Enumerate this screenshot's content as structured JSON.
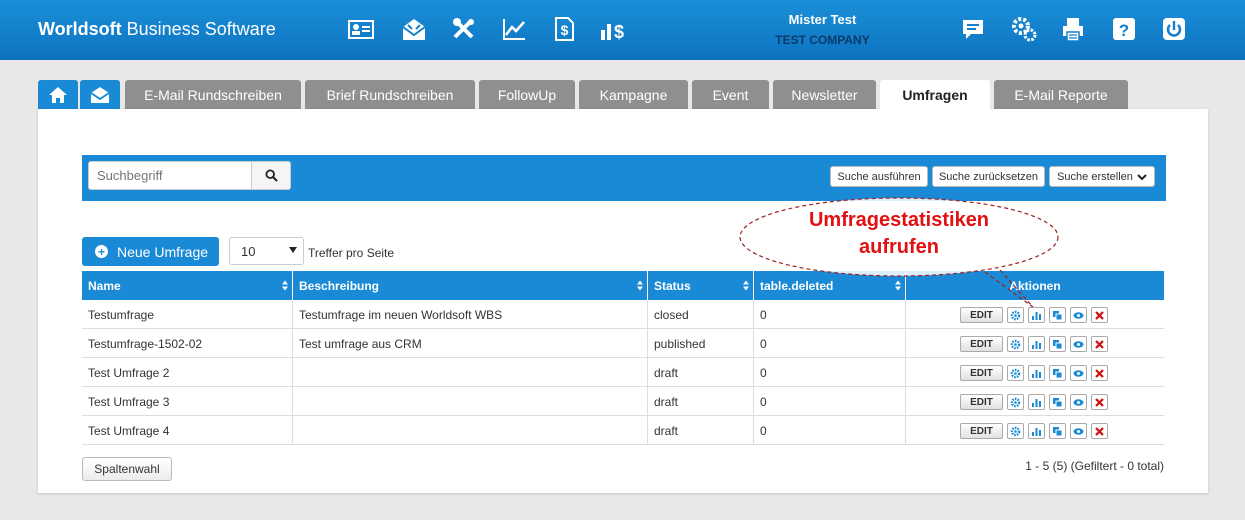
{
  "app": {
    "brand_bold": "Worldsoft",
    "brand_rest": " Business Software"
  },
  "topnav": {
    "icons": [
      "contact-card-icon",
      "mail-broadcast-icon",
      "tools-icon",
      "chart-line-icon",
      "invoice-dollar-icon",
      "bar-dollar-icon"
    ],
    "right_icons": [
      "chat-icon",
      "settings-gears-icon",
      "print-icon",
      "help-icon",
      "power-icon"
    ]
  },
  "user": {
    "name": "Mister Test",
    "company": "TEST COMPANY"
  },
  "tabs": [
    {
      "label": "E-Mail Rundschreiben"
    },
    {
      "label": "Brief Rundschreiben"
    },
    {
      "label": "FollowUp"
    },
    {
      "label": "Kampagne"
    },
    {
      "label": "Event"
    },
    {
      "label": "Newsletter"
    },
    {
      "label": "Umfragen"
    },
    {
      "label": "E-Mail Reporte"
    }
  ],
  "active_tab": "Umfragen",
  "search": {
    "placeholder": "Suchbegriff",
    "execute_label": "Suche ausführen",
    "reset_label": "Suche zurücksetzen",
    "create_label": "Suche erstellen"
  },
  "toolbar": {
    "new_label": "Neue Umfrage",
    "per_page_value": "10",
    "per_page_label": "Treffer pro Seite"
  },
  "table": {
    "columns": [
      "Name",
      "Beschreibung",
      "Status",
      "table.deleted",
      "Aktionen"
    ],
    "rows": [
      {
        "name": "Testumfrage",
        "description": "Testumfrage im neuen Worldsoft WBS",
        "status": "closed",
        "deleted": "0"
      },
      {
        "name": "Testumfrage-1502-02",
        "description": "Test umfrage aus CRM",
        "status": "published",
        "deleted": "0"
      },
      {
        "name": "Test Umfrage 2",
        "description": "",
        "status": "draft",
        "deleted": "0"
      },
      {
        "name": "Test Umfrage 3",
        "description": "",
        "status": "draft",
        "deleted": "0"
      },
      {
        "name": "Test Umfrage 4",
        "description": "",
        "status": "draft",
        "deleted": "0"
      }
    ],
    "edit_label": "EDIT",
    "action_icons": [
      "settings-icon",
      "statistics-icon",
      "copy-icon",
      "preview-icon",
      "delete-icon"
    ]
  },
  "footer": {
    "columns_button": "Spaltenwahl",
    "pager_info": "1 - 5 (5) (Gefiltert - 0 total)"
  },
  "callout": {
    "line1": "Umfragestatistiken",
    "line2": "aufrufen"
  },
  "colors": {
    "header_blue": "#1a8ad6",
    "tab_gray": "#8f8f8f",
    "callout_red": "#e21010"
  }
}
